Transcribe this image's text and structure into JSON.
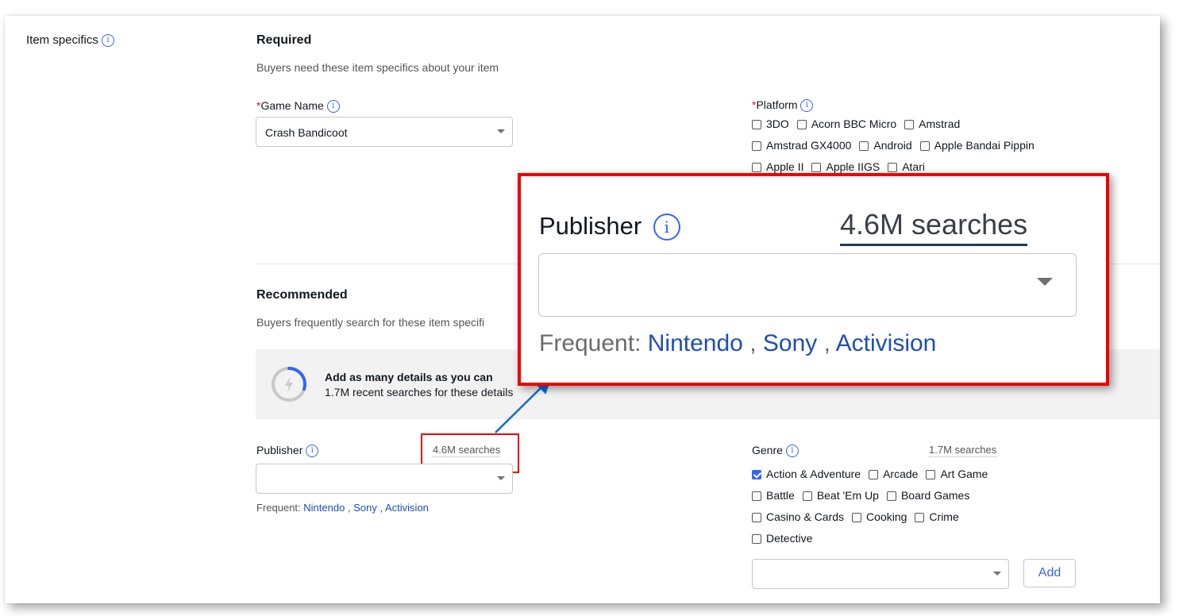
{
  "section": {
    "label": "Item specifics"
  },
  "required": {
    "heading": "Required",
    "description": "Buyers need these item specifics about your item",
    "game_name": {
      "asterisk": "*",
      "label": "Game Name",
      "value": "Crash Bandicoot"
    },
    "platform": {
      "asterisk": "*",
      "label": "Platform",
      "options": [
        [
          "3DO",
          "Acorn BBC Micro",
          "Amstrad"
        ],
        [
          "Amstrad GX4000",
          "Android",
          "Apple Bandai Pippin"
        ],
        [
          "Apple II",
          "Apple IIGS",
          "Atari"
        ]
      ]
    }
  },
  "recommended": {
    "heading": "Recommended",
    "description": "Buyers frequently search for these item specifi",
    "banner": {
      "title": "Add as many details as you can",
      "subtitle": "1.7M recent searches for these details",
      "progress": 0.3
    },
    "publisher": {
      "label": "Publisher",
      "searches": "4.6M searches",
      "value": "",
      "frequent_label": "Frequent:",
      "frequent": [
        "Nintendo",
        "Sony",
        "Activision"
      ],
      "separator": ","
    },
    "genre": {
      "label": "Genre",
      "searches": "1.7M searches",
      "options": [
        [
          {
            "label": "Action & Adventure",
            "checked": true
          },
          {
            "label": "Arcade",
            "checked": false
          },
          {
            "label": "Art Game",
            "checked": false
          }
        ],
        [
          {
            "label": "Battle",
            "checked": false
          },
          {
            "label": "Beat 'Em Up",
            "checked": false
          },
          {
            "label": "Board Games",
            "checked": false
          }
        ],
        [
          {
            "label": "Casino & Cards",
            "checked": false
          },
          {
            "label": "Cooking",
            "checked": false
          },
          {
            "label": "Crime",
            "checked": false
          }
        ],
        [
          {
            "label": "Detective",
            "checked": false
          }
        ]
      ],
      "add_label": "Add"
    }
  },
  "zoom_callout": {
    "label": "Publisher",
    "searches": "4.6M searches",
    "frequent_label": "Frequent:",
    "frequent": [
      "Nintendo",
      "Sony",
      "Activision"
    ],
    "separator": ","
  },
  "colors": {
    "accent": "#3665f3",
    "link": "#1d4fb3",
    "highlight": "#e00000",
    "required": "#e0103a"
  }
}
